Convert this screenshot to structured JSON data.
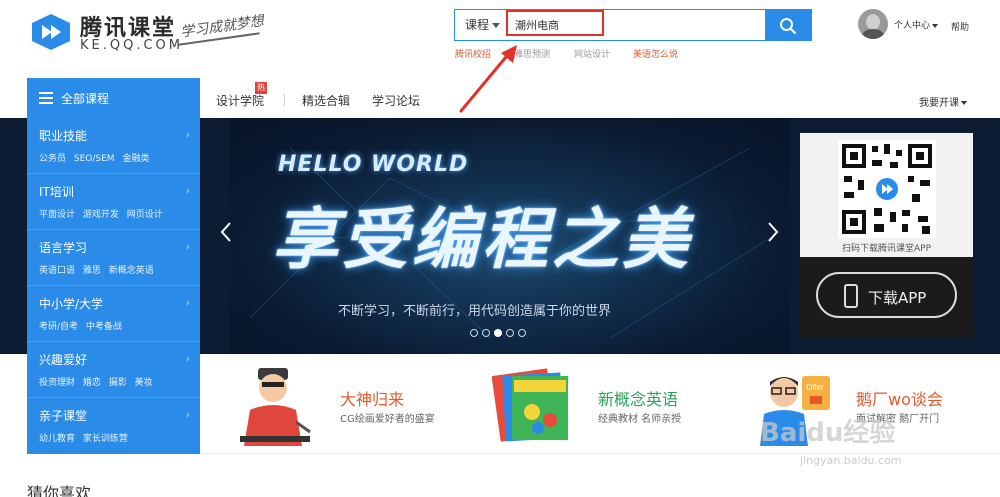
{
  "header": {
    "logo_title": "腾讯课堂",
    "logo_domain": "KE.QQ.COM",
    "logo_slogan": "学习成就梦想",
    "search": {
      "category": "课程",
      "value": "潮州电商",
      "placeholder": ""
    },
    "hot_words": [
      {
        "label": "腾讯校招",
        "color": "#e25a2c"
      },
      {
        "label": "雅思预测",
        "color": "#999999"
      },
      {
        "label": "网站设计",
        "color": "#999999"
      },
      {
        "label": "美语怎么说",
        "color": "#e25a2c"
      }
    ],
    "personal_center": "个人中心",
    "help": "帮助"
  },
  "nav": {
    "all_courses": "全部课程",
    "links": [
      "设计学院",
      "精选合辑",
      "学习论坛"
    ],
    "hot_badge": "热",
    "open_course": "我要开课"
  },
  "sidebar": {
    "categories": [
      {
        "title": "职业技能",
        "subs": [
          "公务员",
          "SEO/SEM",
          "金融类"
        ]
      },
      {
        "title": "IT培训",
        "subs": [
          "平面设计",
          "游戏开发",
          "网页设计"
        ]
      },
      {
        "title": "语言学习",
        "subs": [
          "英语口语",
          "雅思",
          "新概念英语"
        ]
      },
      {
        "title": "中小学/大学",
        "subs": [
          "考研/自考",
          "中考备战"
        ]
      },
      {
        "title": "兴趣爱好",
        "subs": [
          "投资理财",
          "婚恋",
          "摄影",
          "美妆"
        ]
      },
      {
        "title": "亲子课堂",
        "subs": [
          "幼儿教育",
          "家长训练营"
        ]
      }
    ]
  },
  "banner": {
    "hello": "HELLO WORLD",
    "title": "享受编程之美",
    "subtitle": "不断学习，不断前行，用代码创造属于你的世界",
    "dots": 5,
    "active_dot": 2
  },
  "app_panel": {
    "caption": "扫码下载腾讯课堂APP",
    "download": "下载APP"
  },
  "promos": [
    {
      "title": "大神归来",
      "subtitle": "CG绘画爱好者的盛宴",
      "title_color": "#e25a2c"
    },
    {
      "title": "新概念英语",
      "subtitle": "经典教材 名师亲授",
      "title_color": "#27a35a"
    },
    {
      "title": "鹅厂wo谈会",
      "subtitle": "面试解密 鹅厂开门",
      "title_color": "#e25a2c"
    }
  ],
  "section_title": "猜你喜欢",
  "watermark": "Baidu经验",
  "watermark_sub": "jingyan.baidu.com",
  "colors": {
    "brand_blue": "#2a8be8",
    "highlight_red": "#e0322b"
  }
}
